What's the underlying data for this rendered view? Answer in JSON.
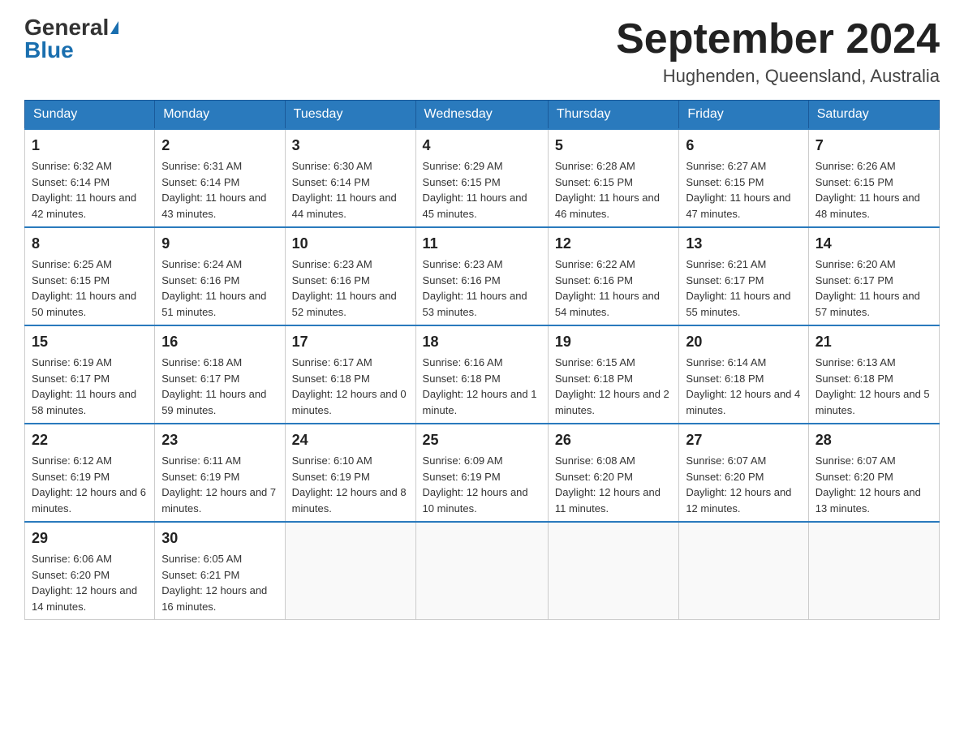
{
  "header": {
    "logo_general": "General",
    "logo_blue": "Blue",
    "month_title": "September 2024",
    "location": "Hughenden, Queensland, Australia"
  },
  "days_of_week": [
    "Sunday",
    "Monday",
    "Tuesday",
    "Wednesday",
    "Thursday",
    "Friday",
    "Saturday"
  ],
  "weeks": [
    [
      {
        "day": "1",
        "sunrise": "6:32 AM",
        "sunset": "6:14 PM",
        "daylight": "11 hours and 42 minutes."
      },
      {
        "day": "2",
        "sunrise": "6:31 AM",
        "sunset": "6:14 PM",
        "daylight": "11 hours and 43 minutes."
      },
      {
        "day": "3",
        "sunrise": "6:30 AM",
        "sunset": "6:14 PM",
        "daylight": "11 hours and 44 minutes."
      },
      {
        "day": "4",
        "sunrise": "6:29 AM",
        "sunset": "6:15 PM",
        "daylight": "11 hours and 45 minutes."
      },
      {
        "day": "5",
        "sunrise": "6:28 AM",
        "sunset": "6:15 PM",
        "daylight": "11 hours and 46 minutes."
      },
      {
        "day": "6",
        "sunrise": "6:27 AM",
        "sunset": "6:15 PM",
        "daylight": "11 hours and 47 minutes."
      },
      {
        "day": "7",
        "sunrise": "6:26 AM",
        "sunset": "6:15 PM",
        "daylight": "11 hours and 48 minutes."
      }
    ],
    [
      {
        "day": "8",
        "sunrise": "6:25 AM",
        "sunset": "6:15 PM",
        "daylight": "11 hours and 50 minutes."
      },
      {
        "day": "9",
        "sunrise": "6:24 AM",
        "sunset": "6:16 PM",
        "daylight": "11 hours and 51 minutes."
      },
      {
        "day": "10",
        "sunrise": "6:23 AM",
        "sunset": "6:16 PM",
        "daylight": "11 hours and 52 minutes."
      },
      {
        "day": "11",
        "sunrise": "6:23 AM",
        "sunset": "6:16 PM",
        "daylight": "11 hours and 53 minutes."
      },
      {
        "day": "12",
        "sunrise": "6:22 AM",
        "sunset": "6:16 PM",
        "daylight": "11 hours and 54 minutes."
      },
      {
        "day": "13",
        "sunrise": "6:21 AM",
        "sunset": "6:17 PM",
        "daylight": "11 hours and 55 minutes."
      },
      {
        "day": "14",
        "sunrise": "6:20 AM",
        "sunset": "6:17 PM",
        "daylight": "11 hours and 57 minutes."
      }
    ],
    [
      {
        "day": "15",
        "sunrise": "6:19 AM",
        "sunset": "6:17 PM",
        "daylight": "11 hours and 58 minutes."
      },
      {
        "day": "16",
        "sunrise": "6:18 AM",
        "sunset": "6:17 PM",
        "daylight": "11 hours and 59 minutes."
      },
      {
        "day": "17",
        "sunrise": "6:17 AM",
        "sunset": "6:18 PM",
        "daylight": "12 hours and 0 minutes."
      },
      {
        "day": "18",
        "sunrise": "6:16 AM",
        "sunset": "6:18 PM",
        "daylight": "12 hours and 1 minute."
      },
      {
        "day": "19",
        "sunrise": "6:15 AM",
        "sunset": "6:18 PM",
        "daylight": "12 hours and 2 minutes."
      },
      {
        "day": "20",
        "sunrise": "6:14 AM",
        "sunset": "6:18 PM",
        "daylight": "12 hours and 4 minutes."
      },
      {
        "day": "21",
        "sunrise": "6:13 AM",
        "sunset": "6:18 PM",
        "daylight": "12 hours and 5 minutes."
      }
    ],
    [
      {
        "day": "22",
        "sunrise": "6:12 AM",
        "sunset": "6:19 PM",
        "daylight": "12 hours and 6 minutes."
      },
      {
        "day": "23",
        "sunrise": "6:11 AM",
        "sunset": "6:19 PM",
        "daylight": "12 hours and 7 minutes."
      },
      {
        "day": "24",
        "sunrise": "6:10 AM",
        "sunset": "6:19 PM",
        "daylight": "12 hours and 8 minutes."
      },
      {
        "day": "25",
        "sunrise": "6:09 AM",
        "sunset": "6:19 PM",
        "daylight": "12 hours and 10 minutes."
      },
      {
        "day": "26",
        "sunrise": "6:08 AM",
        "sunset": "6:20 PM",
        "daylight": "12 hours and 11 minutes."
      },
      {
        "day": "27",
        "sunrise": "6:07 AM",
        "sunset": "6:20 PM",
        "daylight": "12 hours and 12 minutes."
      },
      {
        "day": "28",
        "sunrise": "6:07 AM",
        "sunset": "6:20 PM",
        "daylight": "12 hours and 13 minutes."
      }
    ],
    [
      {
        "day": "29",
        "sunrise": "6:06 AM",
        "sunset": "6:20 PM",
        "daylight": "12 hours and 14 minutes."
      },
      {
        "day": "30",
        "sunrise": "6:05 AM",
        "sunset": "6:21 PM",
        "daylight": "12 hours and 16 minutes."
      },
      null,
      null,
      null,
      null,
      null
    ]
  ],
  "labels": {
    "sunrise": "Sunrise:",
    "sunset": "Sunset:",
    "daylight": "Daylight:"
  }
}
